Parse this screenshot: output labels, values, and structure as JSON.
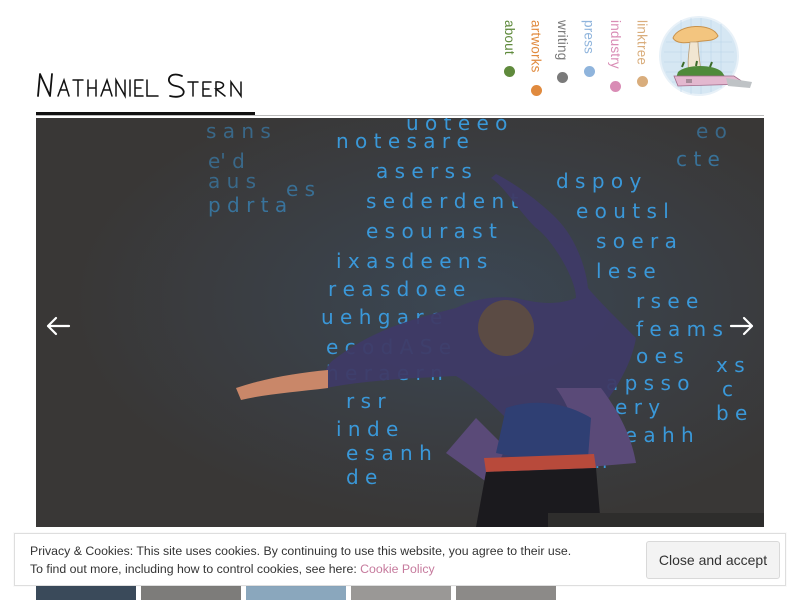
{
  "site": {
    "logo_text": "Nathaniel Stern"
  },
  "nav": {
    "items": [
      {
        "label": "about",
        "color": "#5f8a3c"
      },
      {
        "label": "artworks",
        "color": "#e08a3e"
      },
      {
        "label": "writing",
        "color": "#7a7a7a"
      },
      {
        "label": "press",
        "color": "#8fb4dc"
      },
      {
        "label": "industry",
        "color": "#d98cb5"
      },
      {
        "label": "linktree",
        "color": "#d9ad7c"
      }
    ]
  },
  "slideshow": {
    "prev_icon": "arrow-left-icon",
    "next_icon": "arrow-right-icon",
    "projected_text_color": "#3aa0e6"
  },
  "thumbnails": {
    "count": 5
  },
  "cookie": {
    "text_1": "Privacy & Cookies: This site uses cookies. By continuing to use this website, you agree to their use.",
    "text_2": "To find out more, including how to control cookies, see here: ",
    "link_label": "Cookie Policy",
    "accept_label": "Close and accept"
  }
}
